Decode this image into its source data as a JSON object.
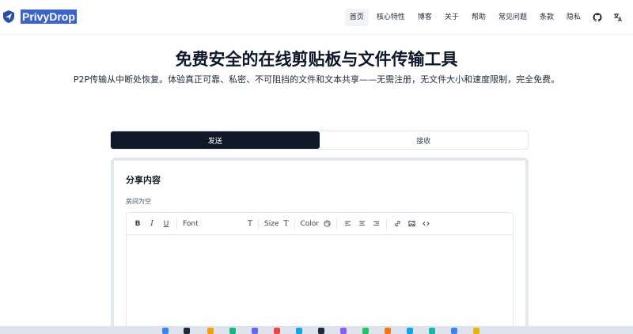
{
  "brand": {
    "name": "PrivyDrop"
  },
  "nav": {
    "items": [
      {
        "label": "首页",
        "active": true
      },
      {
        "label": "核心特性",
        "active": false
      },
      {
        "label": "博客",
        "active": false
      },
      {
        "label": "关于",
        "active": false
      },
      {
        "label": "帮助",
        "active": false
      },
      {
        "label": "常见问题",
        "active": false
      },
      {
        "label": "条款",
        "active": false
      },
      {
        "label": "隐私",
        "active": false
      }
    ]
  },
  "hero": {
    "title": "免费安全的在线剪贴板与文件传输工具",
    "subtitle": "P2P传输从中断处恢复。体验真正可靠、私密、不可阻挡的文件和文本共享——无需注册，无文件大小和速度限制，完全免费。"
  },
  "tabs": {
    "send": "发送",
    "receive": "接收"
  },
  "card": {
    "title": "分享内容",
    "room_status": "房间为空"
  },
  "toolbar": {
    "bold": "B",
    "italic": "I",
    "underline": "U",
    "font_label": "Font",
    "size_label": "Size",
    "color_label": "Color",
    "t_glyph": "T"
  },
  "colors": {
    "primary": "#111827",
    "brand_highlight": "#3b63c8",
    "card_border": "#e3e8ee"
  }
}
